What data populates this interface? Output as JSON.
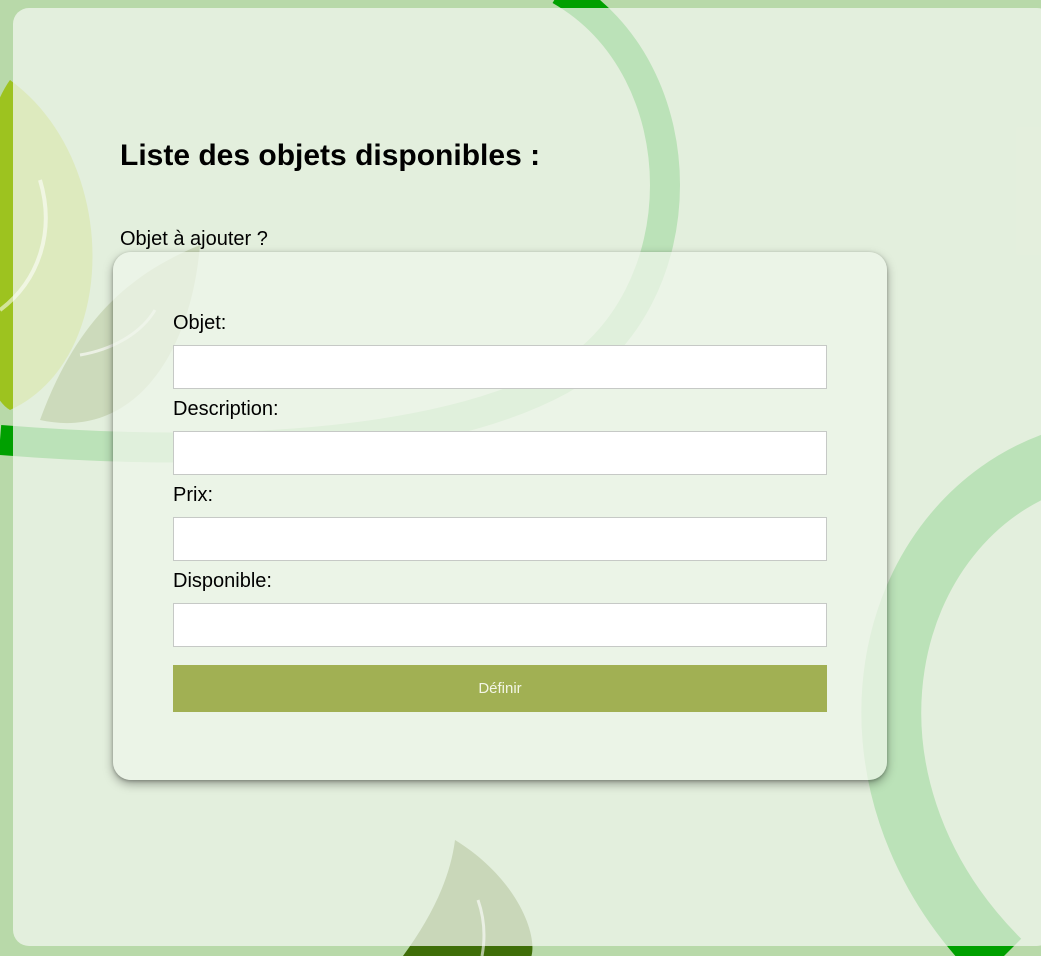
{
  "page": {
    "title": "Liste des objets disponibles :",
    "subtitle": "Objet à ajouter ?"
  },
  "form": {
    "fields": [
      {
        "label": "Objet:",
        "value": "",
        "placeholder": ""
      },
      {
        "label": "Description:",
        "value": "",
        "placeholder": ""
      },
      {
        "label": "Prix:",
        "value": "",
        "placeholder": ""
      },
      {
        "label": "Disponible:",
        "value": "",
        "placeholder": ""
      }
    ],
    "submit_label": "Définir"
  },
  "theme": {
    "background": "#b8d9a9",
    "accent_green": "#00a300",
    "button_color": "#a1b053",
    "leaf_color": "#9dc31f"
  }
}
